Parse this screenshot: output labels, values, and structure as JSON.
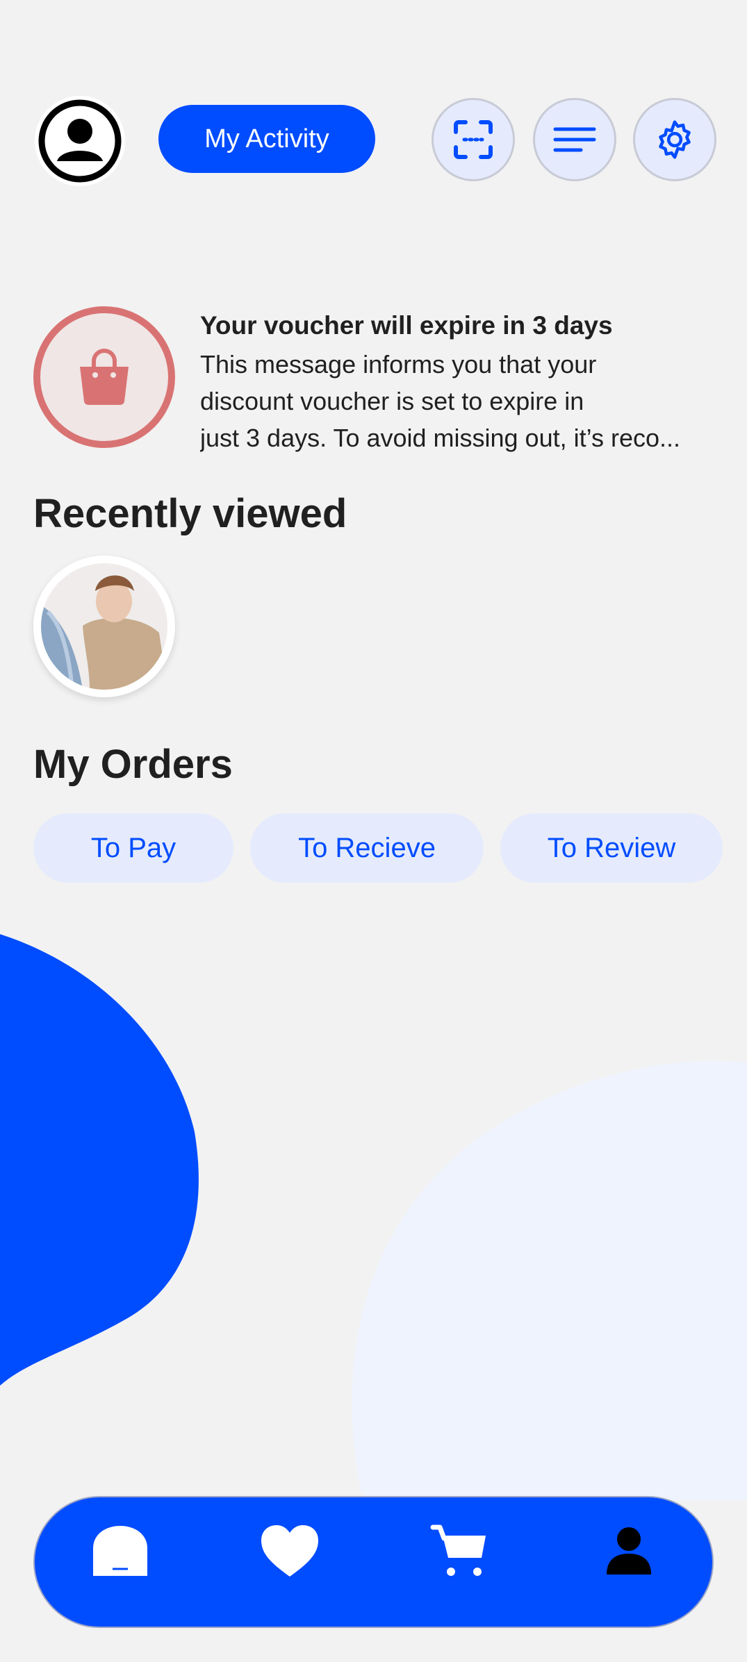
{
  "colors": {
    "background": "#f2f2f2",
    "accent": "#004cff",
    "accent_light": "#e5ebfc",
    "voucher": "#d97373"
  },
  "header": {
    "activity_label": "My Activity",
    "icons": [
      "account-circle-icon",
      "scan-icon",
      "menu-icon",
      "settings-icon"
    ]
  },
  "voucher": {
    "title": "Your voucher will expire in 3 days",
    "lines": [
      "This message informs you that your",
      "discount voucher is set to expire in",
      "just 3 days. To avoid missing out, it’s reco..."
    ],
    "icon": "shopping-bag-icon"
  },
  "recent": {
    "title": "Recently viewed",
    "items": [
      {
        "icon": "product-thumbnail"
      }
    ]
  },
  "orders": {
    "title": "My Orders",
    "tabs": [
      {
        "label": "To Pay"
      },
      {
        "label": "To Recieve"
      },
      {
        "label": "To Review"
      }
    ]
  },
  "bottom_nav": {
    "items": [
      "home-icon",
      "heart-icon",
      "cart-icon",
      "profile-icon"
    ],
    "active": "profile-icon"
  }
}
